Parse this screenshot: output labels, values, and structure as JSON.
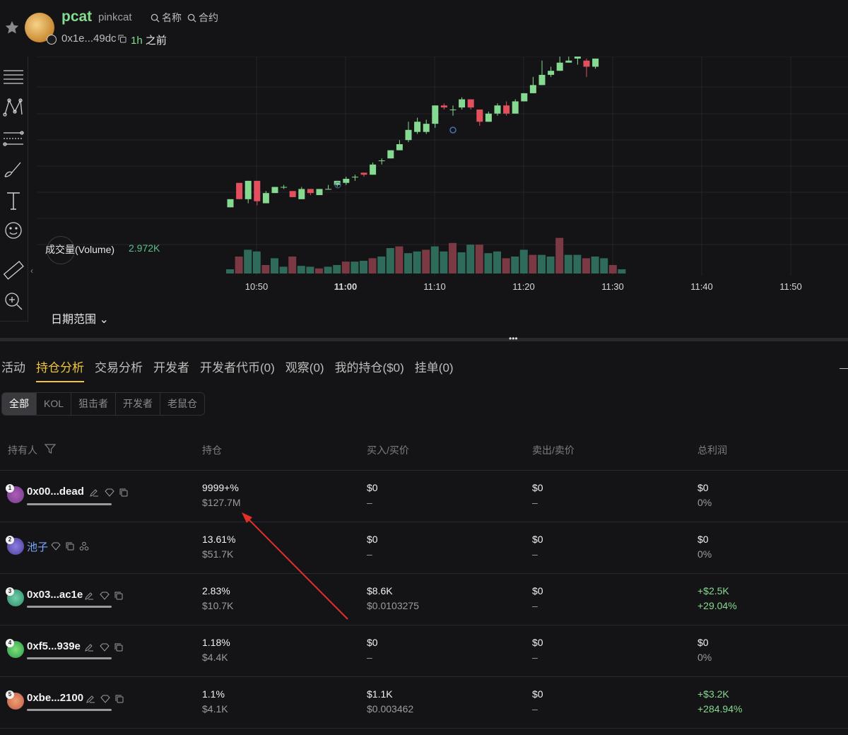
{
  "header": {
    "symbol": "pcat",
    "token_name": "pinkcat",
    "search_name": "名称",
    "search_contract": "合约",
    "address": "0x1e...49dc",
    "age_value": "1h",
    "age_suffix": "之前"
  },
  "chart": {
    "volume_label": "成交量(Volume)",
    "volume_value": "2.972K",
    "date_range_label": "日期范围",
    "colors": {
      "up": "#86d990",
      "down": "#e24f5d",
      "vol_up": "#2f6b5a",
      "vol_down": "#7b3944"
    }
  },
  "chart_data": {
    "type": "candlestick",
    "x_ticks": [
      "10:50",
      "11:00",
      "11:10",
      "11:20",
      "11:30",
      "11:40",
      "11:50"
    ],
    "candles": [
      {
        "o": 208,
        "c": 212,
        "h": 212,
        "l": 208
      },
      {
        "o": 220,
        "c": 212,
        "h": 220,
        "l": 212
      },
      {
        "o": 212,
        "c": 221,
        "h": 221,
        "l": 210
      },
      {
        "o": 221,
        "c": 211,
        "h": 221,
        "l": 209
      },
      {
        "o": 210,
        "c": 215,
        "h": 216,
        "l": 210
      },
      {
        "o": 215,
        "c": 218,
        "h": 218,
        "l": 215
      },
      {
        "o": 218,
        "c": 218,
        "h": 219,
        "l": 217
      },
      {
        "o": 216,
        "c": 213,
        "h": 216,
        "l": 213
      },
      {
        "o": 212,
        "c": 217,
        "h": 218,
        "l": 212
      },
      {
        "o": 217,
        "c": 215,
        "h": 217,
        "l": 214
      },
      {
        "o": 214,
        "c": 217,
        "h": 217,
        "l": 214
      },
      {
        "o": 217,
        "c": 217,
        "h": 219,
        "l": 217
      },
      {
        "o": 219,
        "c": 221,
        "h": 221,
        "l": 218
      },
      {
        "o": 220,
        "c": 222,
        "h": 223,
        "l": 219
      },
      {
        "o": 223,
        "c": 223,
        "h": 224,
        "l": 221
      },
      {
        "o": 225,
        "c": 224,
        "h": 225,
        "l": 223
      },
      {
        "o": 224,
        "c": 229,
        "h": 230,
        "l": 224
      },
      {
        "o": 231,
        "c": 231,
        "h": 232,
        "l": 229
      },
      {
        "o": 232,
        "c": 236,
        "h": 236,
        "l": 232
      },
      {
        "o": 236,
        "c": 239,
        "h": 241,
        "l": 236
      },
      {
        "o": 241,
        "c": 246,
        "h": 250,
        "l": 240
      },
      {
        "o": 245,
        "c": 250,
        "h": 252,
        "l": 244
      },
      {
        "o": 245,
        "c": 249,
        "h": 251,
        "l": 244
      },
      {
        "o": 249,
        "c": 258,
        "h": 258,
        "l": 247
      },
      {
        "o": 258,
        "c": 257,
        "h": 259,
        "l": 256
      },
      {
        "o": 256,
        "c": 256,
        "h": 258,
        "l": 253
      },
      {
        "o": 257,
        "c": 261,
        "h": 262,
        "l": 256
      },
      {
        "o": 261,
        "c": 257,
        "h": 261,
        "l": 256
      },
      {
        "o": 256,
        "c": 250,
        "h": 256,
        "l": 248
      },
      {
        "o": 250,
        "c": 254,
        "h": 255,
        "l": 250
      },
      {
        "o": 254,
        "c": 258,
        "h": 259,
        "l": 253
      },
      {
        "o": 258,
        "c": 254,
        "h": 260,
        "l": 253
      },
      {
        "o": 254,
        "c": 260,
        "h": 261,
        "l": 254
      },
      {
        "o": 260,
        "c": 264,
        "h": 264,
        "l": 260
      },
      {
        "o": 264,
        "c": 268,
        "h": 272,
        "l": 264
      },
      {
        "o": 268,
        "c": 273,
        "h": 280,
        "l": 268
      },
      {
        "o": 273,
        "c": 275,
        "h": 277,
        "l": 272
      },
      {
        "o": 275,
        "c": 279,
        "h": 284,
        "l": 275
      },
      {
        "o": 279,
        "c": 280,
        "h": 282,
        "l": 279
      },
      {
        "o": 281,
        "c": 282,
        "h": 282,
        "l": 278
      },
      {
        "o": 280,
        "c": 277,
        "h": 281,
        "l": 272
      },
      {
        "o": 277,
        "c": 281,
        "h": 281,
        "l": 276
      }
    ],
    "volumes": [
      5,
      20,
      28,
      26,
      10,
      18,
      8,
      20,
      9,
      8,
      6,
      8,
      10,
      14,
      14,
      15,
      18,
      20,
      30,
      32,
      24,
      26,
      28,
      32,
      26,
      36,
      25,
      34,
      34,
      24,
      26,
      18,
      20,
      28,
      22,
      22,
      20,
      42,
      22,
      22,
      18,
      20,
      18,
      10,
      5
    ]
  },
  "tabs": [
    "活动",
    "持仓分析",
    "交易分析",
    "开发者",
    "开发者代币(0)",
    "观察(0)",
    "我的持仓($0)",
    "挂单(0)"
  ],
  "active_tab": "持仓分析",
  "filters": [
    "全部",
    "KOL",
    "狙击者",
    "开发者",
    "老鼠仓"
  ],
  "table": {
    "headers": {
      "holder": "持有人",
      "position": "持仓",
      "buy": "买入/买价",
      "sell": "卖出/卖价",
      "profit": "总利润"
    },
    "rows": [
      {
        "rank": "1",
        "holder": "0x00...dead",
        "position": "9999+%",
        "position_usd": "$127.7M",
        "buy": "$0",
        "buy_price": "–",
        "sell": "$0",
        "sell_price": "–",
        "profit": "$0",
        "profit_pct": "0%"
      },
      {
        "rank": "2",
        "holder": "池子",
        "position": "13.61%",
        "position_usd": "$51.7K",
        "buy": "$0",
        "buy_price": "–",
        "sell": "$0",
        "sell_price": "–",
        "profit": "$0",
        "profit_pct": "0%"
      },
      {
        "rank": "3",
        "holder": "0x03...ac1e",
        "position": "2.83%",
        "position_usd": "$10.7K",
        "buy": "$8.6K",
        "buy_price": "$0.0103275",
        "sell": "$0",
        "sell_price": "–",
        "profit": "+$2.5K",
        "profit_pct": "+29.04%"
      },
      {
        "rank": "4",
        "holder": "0xf5...939e",
        "position": "1.18%",
        "position_usd": "$4.4K",
        "buy": "$0",
        "buy_price": "–",
        "sell": "$0",
        "sell_price": "–",
        "profit": "$0",
        "profit_pct": "0%"
      },
      {
        "rank": "5",
        "holder": "0xbe...2100",
        "position": "1.1%",
        "position_usd": "$4.1K",
        "buy": "$1.1K",
        "buy_price": "$0.003462",
        "sell": "$0",
        "sell_price": "–",
        "profit": "+$3.2K",
        "profit_pct": "+284.94%"
      }
    ]
  }
}
